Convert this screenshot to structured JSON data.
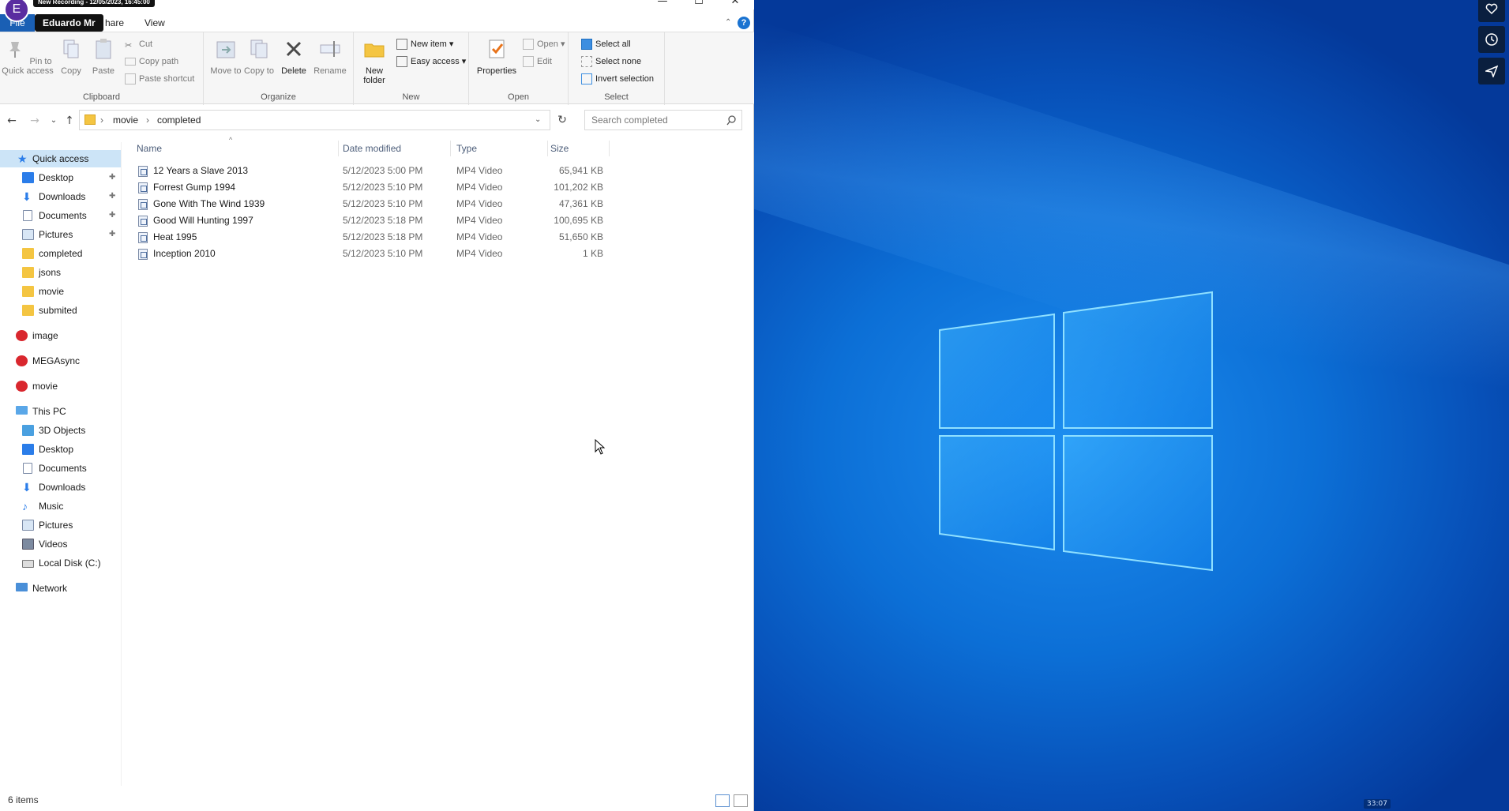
{
  "recording": {
    "badge": "New Recording - 12/05/2023, 16:45:00",
    "avatar_letter": "E",
    "user_name": "Eduardo Mr"
  },
  "window": {
    "minimize": "—",
    "maximize": "☐",
    "close": "✕"
  },
  "menu": {
    "file": "File",
    "share": "hare",
    "view": "View"
  },
  "ribbon": {
    "clipboard": {
      "label": "Clipboard",
      "pin": "Pin to Quick access",
      "copy": "Copy",
      "paste": "Paste",
      "cut": "Cut",
      "copy_path": "Copy path",
      "paste_shortcut": "Paste shortcut"
    },
    "organize": {
      "label": "Organize",
      "move_to": "Move to",
      "copy_to": "Copy to",
      "delete": "Delete",
      "rename": "Rename"
    },
    "new": {
      "label": "New",
      "new_folder": "New folder",
      "new_item": "New item ▾",
      "easy_access": "Easy access ▾"
    },
    "open": {
      "label": "Open",
      "properties": "Properties",
      "open": "Open ▾",
      "edit": "Edit"
    },
    "select": {
      "label": "Select",
      "select_all": "Select all",
      "select_none": "Select none",
      "invert": "Invert selection"
    }
  },
  "address": {
    "crumbs": [
      "movie",
      "completed"
    ],
    "search_placeholder": "Search completed"
  },
  "nav": {
    "quick_access": "Quick access",
    "quick_items": [
      "Desktop",
      "Downloads",
      "Documents",
      "Pictures",
      "completed",
      "jsons",
      "movie",
      "submited"
    ],
    "cloud": [
      "image",
      "MEGAsync",
      "movie"
    ],
    "this_pc": "This PC",
    "pc_items": [
      "3D Objects",
      "Desktop",
      "Documents",
      "Downloads",
      "Music",
      "Pictures",
      "Videos",
      "Local Disk (C:)"
    ],
    "network": "Network"
  },
  "columns": {
    "name": "Name",
    "date": "Date modified",
    "type": "Type",
    "size": "Size"
  },
  "files": [
    {
      "name": "12 Years a Slave 2013",
      "date": "5/12/2023 5:00 PM",
      "type": "MP4 Video",
      "size": "65,941 KB"
    },
    {
      "name": "Forrest Gump 1994",
      "date": "5/12/2023 5:10 PM",
      "type": "MP4 Video",
      "size": "101,202 KB"
    },
    {
      "name": "Gone With The Wind 1939",
      "date": "5/12/2023 5:10 PM",
      "type": "MP4 Video",
      "size": "47,361 KB"
    },
    {
      "name": "Good Will Hunting 1997",
      "date": "5/12/2023 5:18 PM",
      "type": "MP4 Video",
      "size": "100,695 KB"
    },
    {
      "name": "Heat 1995",
      "date": "5/12/2023 5:18 PM",
      "type": "MP4 Video",
      "size": "51,650 KB"
    },
    {
      "name": "Inception 2010",
      "date": "5/12/2023 5:10 PM",
      "type": "MP4 Video",
      "size": "1 KB"
    }
  ],
  "status": {
    "item_count": "6 items"
  },
  "desktop": {
    "timer": "33:07",
    "side_icons": [
      "heart-icon",
      "clock-icon",
      "send-icon"
    ]
  },
  "colors": {
    "file_tab": "#1a5fb4",
    "desktop_blue": "#0c6fd6",
    "avatar": "#5a2ca0"
  }
}
